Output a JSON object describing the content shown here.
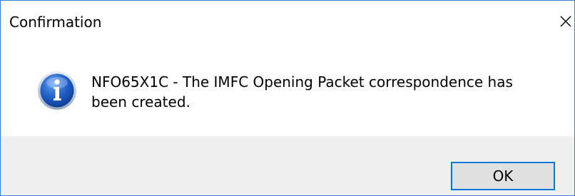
{
  "window": {
    "title": "Confirmation"
  },
  "message": {
    "text": "NFO65X1C - The IMFC Opening Packet correspondence has been created.",
    "icon": "info-icon"
  },
  "buttons": {
    "ok_label": "OK"
  },
  "colors": {
    "accent": "#0078d7",
    "footer_bg": "#f0f0f0",
    "button_bg": "#e1e1e1",
    "window_border": "#3a7bd5"
  }
}
